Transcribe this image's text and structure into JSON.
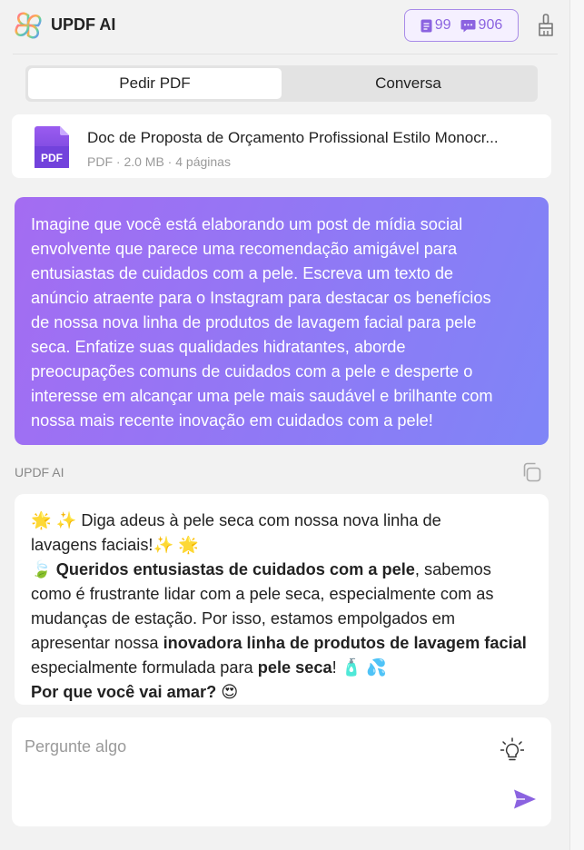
{
  "app": {
    "title": "UPDF AI",
    "quota": {
      "docs": "99",
      "messages": "906"
    }
  },
  "tabs": [
    {
      "label": "Pedir PDF",
      "active": true
    },
    {
      "label": "Conversa",
      "active": false
    }
  ],
  "document": {
    "icon_label": "PDF",
    "title": "Doc de Proposta de Orçamento Profissional Estilo Monocr...",
    "meta": "PDF · 2.0 MB · 4 páginas"
  },
  "prompt": {
    "lines": [
      "Imagine que você está elaborando um post de mídia social",
      "envolvente que parece uma recomendação amigável para",
      "entusiastas de cuidados com a pele. Escreva um texto de",
      "anúncio atraente para o Instagram para destacar os benefícios",
      "de nossa nova linha de produtos de lavagem facial para pele",
      "seca. Enfatize suas qualidades hidratantes, aborde",
      "preocupações comuns de cuidados com a pele e desperte o",
      "interesse em alcançar uma pele mais saudável e brilhante com",
      "nossa mais recente inovação em cuidados com a pele!"
    ]
  },
  "response": {
    "label": "UPDF AI",
    "line1": "🌟 ✨ Diga adeus à pele seca com nossa nova linha de",
    "line2": "lavagens faciais!✨ 🌟",
    "p2_emoji": "🍃 ",
    "p2_bold1": "Queridos entusiastas de cuidados com a pele",
    "p2_text1": ", sabemos como é frustrante lidar com a pele seca, especialmente com as mudanças de estação. Por isso, estamos empolgados em apresentar nossa ",
    "p2_bold2": "inovadora linha de produtos de lavagem facial",
    "p2_text2": " especialmente formulada para ",
    "p2_bold3": "pele seca",
    "p2_text3": "! 🧴 💦",
    "p3_bold": "Por que você vai amar?",
    "p3_emoji": " 😍"
  },
  "input": {
    "placeholder": "Pergunte algo"
  },
  "colors": {
    "accent": "#8b63e0",
    "bubble_start": "#a46cf2",
    "bubble_end": "#7f85f7"
  },
  "icons": [
    "updf-logo-icon",
    "doc-count-icon",
    "message-count-icon",
    "broom-icon",
    "pdf-file-icon",
    "copy-icon",
    "lightbulb-icon",
    "send-icon"
  ]
}
